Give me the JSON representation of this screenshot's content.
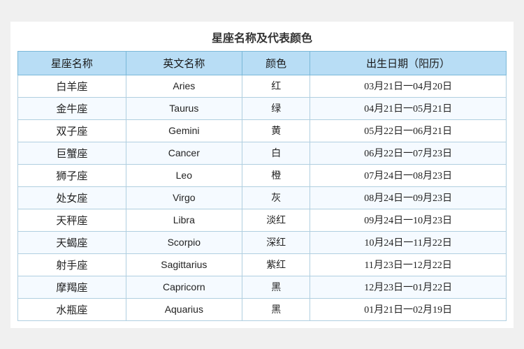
{
  "title": "星座名称及代表颜色",
  "headers": [
    "星座名称",
    "英文名称",
    "颜色",
    "出生日期（阳历）"
  ],
  "rows": [
    {
      "zh": "白羊座",
      "en": "Aries",
      "color": "红",
      "date": "03月21日一04月20日"
    },
    {
      "zh": "金牛座",
      "en": "Taurus",
      "color": "绿",
      "date": "04月21日一05月21日"
    },
    {
      "zh": "双子座",
      "en": "Gemini",
      "color": "黄",
      "date": "05月22日一06月21日"
    },
    {
      "zh": "巨蟹座",
      "en": "Cancer",
      "color": "白",
      "date": "06月22日一07月23日"
    },
    {
      "zh": "狮子座",
      "en": "Leo",
      "color": "橙",
      "date": "07月24日一08月23日"
    },
    {
      "zh": "处女座",
      "en": "Virgo",
      "color": "灰",
      "date": "08月24日一09月23日"
    },
    {
      "zh": "天秤座",
      "en": "Libra",
      "color": "淡红",
      "date": "09月24日一10月23日"
    },
    {
      "zh": "天蝎座",
      "en": "Scorpio",
      "color": "深红",
      "date": "10月24日一11月22日"
    },
    {
      "zh": "射手座",
      "en": "Sagittarius",
      "color": "紫红",
      "date": "11月23日一12月22日"
    },
    {
      "zh": "摩羯座",
      "en": "Capricorn",
      "color": "黑",
      "date": "12月23日一01月22日"
    },
    {
      "zh": "水瓶座",
      "en": "Aquarius",
      "color": "黑",
      "date": "01月21日一02月19日"
    }
  ]
}
